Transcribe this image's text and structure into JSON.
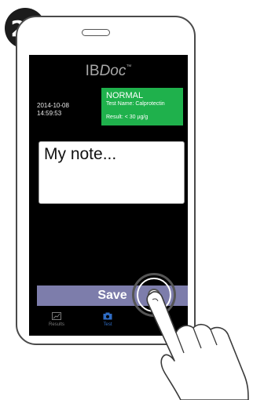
{
  "step": {
    "number": "24"
  },
  "app": {
    "title_prefix": "IB",
    "title_italic": "Doc",
    "title_tm": "™"
  },
  "result_card": {
    "date": "2014-10-08",
    "time": "14:59:53",
    "status": "NORMAL",
    "test_name": "Test Name: Calprotectin",
    "result": "Result: < 30 µg/g",
    "color": "#1fb14c"
  },
  "note": {
    "text": "My note..."
  },
  "save_button": {
    "label": "Save",
    "color": "#7d7dab"
  },
  "tabbar": {
    "tabs": [
      {
        "label": "Results",
        "icon": "chart-icon",
        "active": false
      },
      {
        "label": "Test",
        "icon": "camera-icon",
        "active": true
      },
      {
        "label": "",
        "icon": "monitor-icon",
        "active": false
      }
    ],
    "active_color": "#2f6cc4"
  }
}
